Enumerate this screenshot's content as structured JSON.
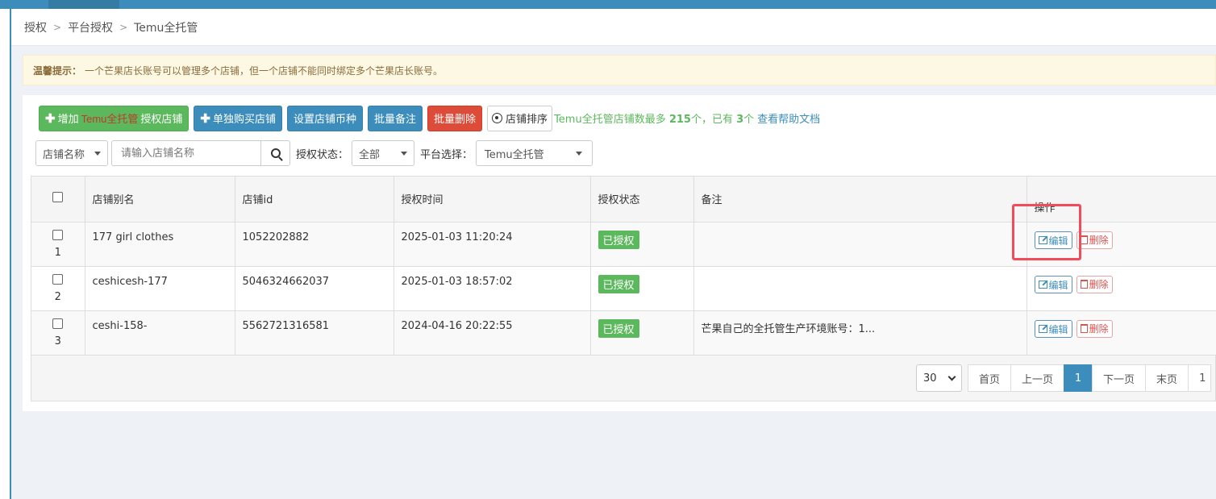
{
  "breadcrumb": [
    "授权",
    "平台授权",
    "Temu全托管"
  ],
  "notice": {
    "label": "温馨提示：",
    "text": "一个芒果店长账号可以管理多个店铺，但一个店铺不能同时绑定多个芒果店长账号。"
  },
  "toolbar": {
    "add_prefix": "增加",
    "add_brand": "Temu全托管",
    "add_suffix": "授权店铺",
    "buy_label": "单独购买店铺",
    "currency_label": "设置店铺币种",
    "batch_note_label": "批量备注",
    "batch_delete_label": "批量删除",
    "sort_label": "店铺排序",
    "limit_prefix": "Temu全托管店铺数最多 ",
    "limit_max": "215",
    "limit_mid": "个，已有 ",
    "limit_count": "3",
    "limit_suffix": "个",
    "help_link": "查看帮助文档"
  },
  "filters": {
    "field_select": "店铺名称",
    "search_placeholder": "请输入店铺名称",
    "auth_label": "授权状态：",
    "auth_value": "全部",
    "platform_label": "平台选择：",
    "platform_value": "Temu全托管"
  },
  "table": {
    "headers": [
      "店铺别名",
      "店铺id",
      "授权时间",
      "授权状态",
      "备注",
      "操作"
    ],
    "rows": [
      {
        "num": "1",
        "alias": "177 girl clothes",
        "id": "1052202882",
        "time": "2025-01-03 11:20:24",
        "status": "已授权",
        "note": "",
        "edit": "编辑",
        "delete": "删除"
      },
      {
        "num": "2",
        "alias": "ceshicesh-177",
        "id": "5046324662037",
        "time": "2025-01-03 18:57:02",
        "status": "已授权",
        "note": "",
        "edit": "编辑",
        "delete": "删除"
      },
      {
        "num": "3",
        "alias": "ceshi-158-",
        "id": "5562721316581",
        "time": "2024-04-16 20:22:55",
        "status": "已授权",
        "note": "芒果自己的全托管生产环境账号：1...",
        "edit": "编辑",
        "delete": "删除"
      }
    ]
  },
  "pager": {
    "page_size": "30",
    "first": "首页",
    "prev": "上一页",
    "current": "1",
    "next": "下一页",
    "last": "末页",
    "partial": "1"
  },
  "colors": {
    "primary": "#3c8dbc",
    "success": "#5cb85c",
    "danger": "#dd4b39",
    "highlight": "#f14b5c"
  }
}
